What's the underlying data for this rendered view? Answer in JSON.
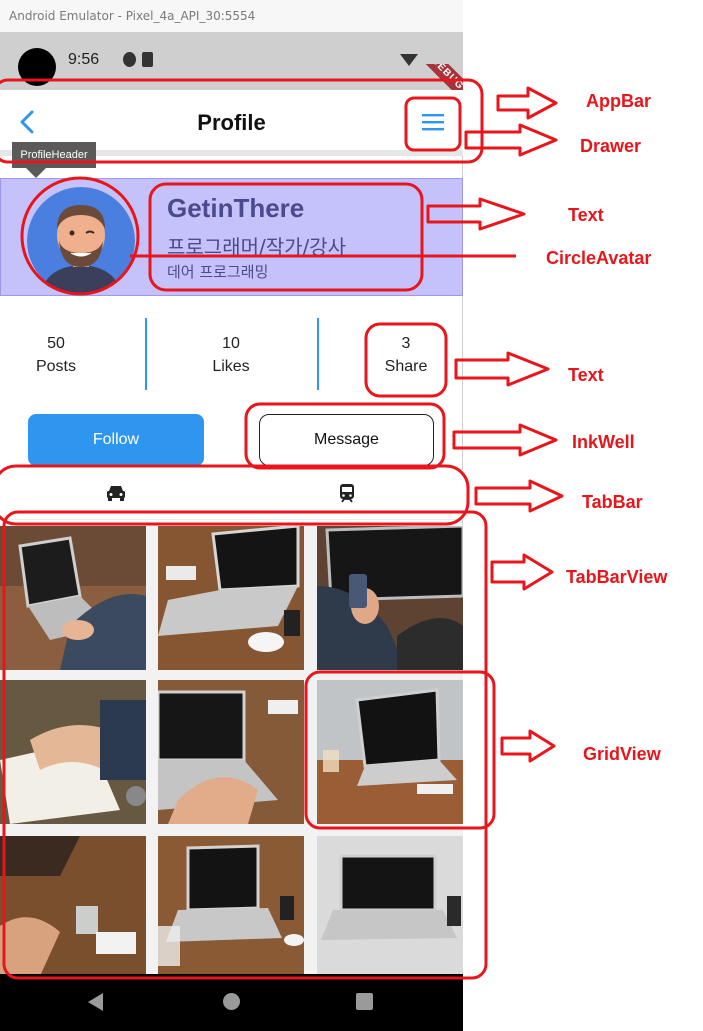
{
  "window": {
    "title": "Android Emulator - Pixel_4a_API_30:5554"
  },
  "status_bar": {
    "time": "9:56",
    "debug_label": "DEBUG"
  },
  "appbar": {
    "title": "Profile",
    "back_icon": "chevron-left-icon",
    "menu_icon": "hamburger-menu-icon",
    "accent": "#2f96ef"
  },
  "tooltip": {
    "text": "ProfileHeader"
  },
  "profile_header": {
    "name": "GetinThere",
    "role": "프로그래머/작가/강사",
    "org": "데어 프로그래밍",
    "background": "#c5c2fb"
  },
  "stats": [
    {
      "value": "50",
      "label": "Posts"
    },
    {
      "value": "10",
      "label": "Likes"
    },
    {
      "value": "3",
      "label": "Share"
    }
  ],
  "buttons": {
    "follow": "Follow",
    "message": "Message"
  },
  "tabs": [
    {
      "icon": "car-icon"
    },
    {
      "icon": "train-icon"
    }
  ],
  "annotations": {
    "appbar": "AppBar",
    "drawer": "Drawer",
    "text1": "Text",
    "circle_avatar": "CircleAvatar",
    "text2": "Text",
    "inkwell": "InkWell",
    "tabbar": "TabBar",
    "tabbarview": "TabBarView",
    "gridview": "GridView"
  }
}
